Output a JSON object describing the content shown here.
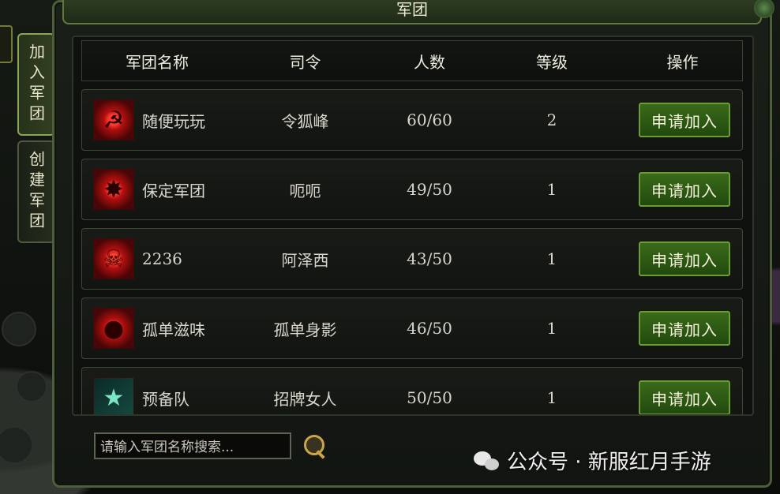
{
  "side_tabs": [
    {
      "label": "加入军团",
      "active": true
    },
    {
      "label": "创建军团",
      "active": false
    }
  ],
  "window": {
    "title": "军团"
  },
  "table": {
    "headers": [
      "军团名称",
      "司令",
      "人数",
      "等级",
      "操作"
    ],
    "rows": [
      {
        "name": "随便玩玩",
        "commander": "令狐峰",
        "members": "60/60",
        "level": "2",
        "action": "申请加入",
        "emblem": "hammer-sickle-icon"
      },
      {
        "name": "保定军团",
        "commander": "呃呃",
        "members": "49/50",
        "level": "1",
        "action": "申请加入",
        "emblem": "red-splash-icon"
      },
      {
        "name": "2236",
        "commander": "阿泽西",
        "members": "43/50",
        "level": "1",
        "action": "申请加入",
        "emblem": "skull-icon"
      },
      {
        "name": "孤单滋味",
        "commander": "孤单身影",
        "members": "46/50",
        "level": "1",
        "action": "申请加入",
        "emblem": "red-orb-icon"
      },
      {
        "name": "预备队",
        "commander": "招牌女人",
        "members": "50/50",
        "level": "1",
        "action": "申请加入",
        "emblem": "green-star-icon"
      }
    ]
  },
  "search": {
    "placeholder": "请输入军团名称搜索..."
  },
  "watermark": {
    "text": "公众号 · 新服红月手游"
  },
  "colors": {
    "button_green": "#2f5e16",
    "border_green": "#5f7a3f",
    "emblem_red": "#c8120f"
  }
}
